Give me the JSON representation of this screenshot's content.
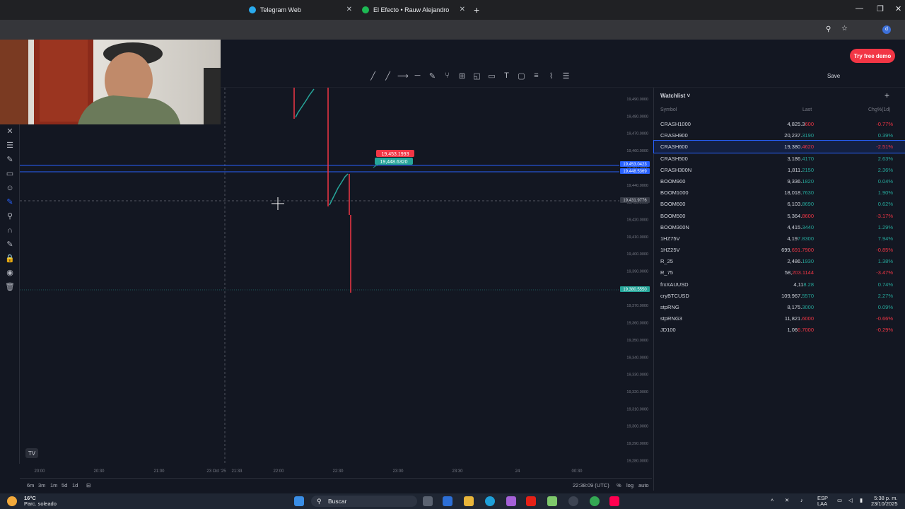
{
  "browser": {
    "tabs": [
      {
        "label": "Telegram Web"
      },
      {
        "label": "El Efecto • Rauw Alejandro"
      }
    ]
  },
  "tradingview": {
    "try_free_demo": "Try free demo",
    "save_label": "Save",
    "price_labels": {
      "pink_tag": "19,453.1993",
      "green_tag": "19,448.6320",
      "line_upper": "19,453.0423",
      "line_lower": "19,448.5369",
      "crosshair": "19,431.9776",
      "current": "19,380.5550"
    },
    "price_ticks": [
      "19,490.0000",
      "19,480.0000",
      "19,470.0000",
      "19,460.0000",
      "19,450.0000",
      "19,440.0000",
      "19,430.0000",
      "19,420.0000",
      "19,410.0000",
      "19,400.0000",
      "19,390.0000",
      "19,380.0000",
      "19,370.0000",
      "19,360.0000",
      "19,350.0000",
      "19,340.0000",
      "19,330.0000",
      "19,320.0000",
      "19,310.0000",
      "19,300.0000",
      "19,290.0000",
      "19,280.0000"
    ],
    "time_ticks": [
      "20:00",
      "20:30",
      "21:00",
      "23 Oct '25",
      "21:33",
      "22:00",
      "22:30",
      "23:00",
      "23:30",
      "24",
      "00:30"
    ],
    "bottom": {
      "ranges": [
        "6m",
        "3m",
        "1m",
        "5d",
        "1d"
      ],
      "clock": "22:38:09 (UTC)",
      "percent": "%",
      "log": "log",
      "auto": "auto"
    }
  },
  "watchlist": {
    "title": "Watchlist",
    "headers": {
      "symbol": "Symbol",
      "last": "Last",
      "chg": "Chg%(1d)"
    },
    "rows": [
      {
        "symbol": "CRASH1000",
        "last_main": "4,825.3",
        "last_tail": "600",
        "chg": "-0.77%",
        "dir": "down"
      },
      {
        "symbol": "CRASH900",
        "last_main": "20,237.",
        "last_tail": "3190",
        "chg": "0.39%",
        "dir": "up"
      },
      {
        "symbol": "CRASH600",
        "last_main": "19,380.",
        "last_tail": "4620",
        "chg": "-2.51%",
        "dir": "down",
        "selected": true
      },
      {
        "symbol": "CRASH500",
        "last_main": "3,186.",
        "last_tail": "4170",
        "chg": "2.63%",
        "dir": "up"
      },
      {
        "symbol": "CRASH300N",
        "last_main": "1,811.",
        "last_tail": "2150",
        "chg": "2.36%",
        "dir": "up"
      },
      {
        "symbol": "BOOM900",
        "last_main": "9,336.",
        "last_tail": "1820",
        "chg": "0.04%",
        "dir": "up"
      },
      {
        "symbol": "BOOM1000",
        "last_main": "18,018.",
        "last_tail": "7630",
        "chg": "1.90%",
        "dir": "up"
      },
      {
        "symbol": "BOOM600",
        "last_main": "6,103.",
        "last_tail": "8690",
        "chg": "0.62%",
        "dir": "up"
      },
      {
        "symbol": "BOOM500",
        "last_main": "5,364.",
        "last_tail": "8600",
        "chg": "-3.17%",
        "dir": "down"
      },
      {
        "symbol": "BOOM300N",
        "last_main": "4,415.",
        "last_tail": "3440",
        "chg": "1.29%",
        "dir": "up"
      },
      {
        "symbol": "1HZ75V",
        "last_main": "4,19",
        "last_tail": "7.8300",
        "chg": "7.94%",
        "dir": "up"
      },
      {
        "symbol": "1HZ25V",
        "last_main": "699,",
        "last_tail": "691.7900",
        "chg": "-0.85%",
        "dir": "down"
      },
      {
        "symbol": "R_25",
        "last_main": "2,486.",
        "last_tail": "1930",
        "chg": "1.38%",
        "dir": "up"
      },
      {
        "symbol": "R_75",
        "last_main": "58,",
        "last_tail": "203.1144",
        "chg": "-3.47%",
        "dir": "down"
      },
      {
        "symbol": "frxXAUUSD",
        "last_main": "4,11",
        "last_tail": "8.28",
        "chg": "0.74%",
        "dir": "up"
      },
      {
        "symbol": "cryBTCUSD",
        "last_main": "109,967.",
        "last_tail": "5570",
        "chg": "2.27%",
        "dir": "up"
      },
      {
        "symbol": "stpRNG",
        "last_main": "8,175.",
        "last_tail": "3000",
        "chg": "0.09%",
        "dir": "up"
      },
      {
        "symbol": "stpRNG3",
        "last_main": "11,821.",
        "last_tail": "6000",
        "chg": "-0.66%",
        "dir": "down"
      },
      {
        "symbol": "JD100",
        "last_main": "1,06",
        "last_tail": "6.7000",
        "chg": "-0.29%",
        "dir": "down"
      }
    ]
  },
  "taskbar": {
    "temp": "16°C",
    "weather": "Parc. soleado",
    "search": "Buscar",
    "lang1": "ESP",
    "lang2": "LAA",
    "time": "5:38 p. m.",
    "date": "23/10/2025"
  },
  "colors": {
    "up": "#26a69a",
    "down": "#f23645",
    "accent": "#2962ff"
  }
}
